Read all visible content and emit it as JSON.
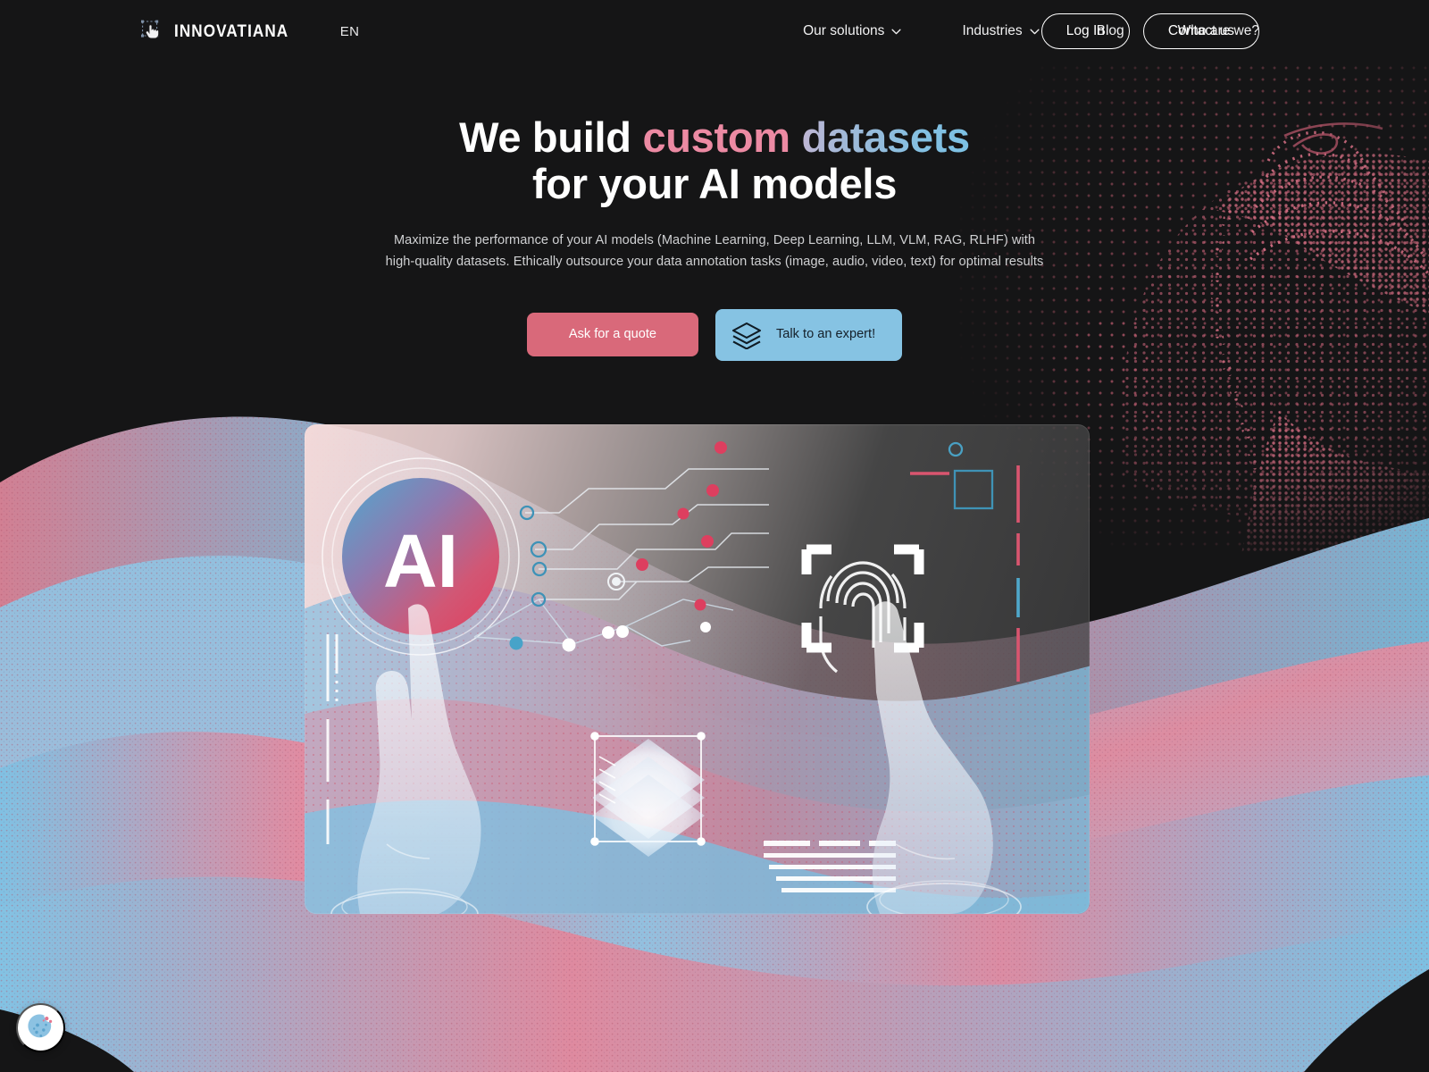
{
  "header": {
    "brand_name": "INNOVATIANA",
    "brand_icon": "hand-pointer-selection-icon",
    "language": "EN",
    "nav": [
      {
        "label": "Our solutions",
        "has_chevron": true,
        "icon": "chevron-down-icon"
      },
      {
        "label": "Industries",
        "has_chevron": true,
        "icon": "chevron-down-icon"
      },
      {
        "label": "Blog",
        "has_chevron": false,
        "icon": ""
      },
      {
        "label": "Who are we?",
        "has_chevron": false,
        "icon": ""
      }
    ],
    "login_label": "Log In",
    "contact_label": "Contact us"
  },
  "hero": {
    "headline_part1": "We build ",
    "headline_custom": "custom",
    "headline_space": " ",
    "headline_datasets": "datasets",
    "headline_line2": "for your AI models",
    "subcopy": "Maximize the performance of your AI models (Machine Learning, Deep Learning, LLM, VLM, RAG, RLHF) with high-quality datasets. Ethically outsource your data annotation tasks (image, audio, video, text) for optimal results",
    "cta_primary": "Ask for a quote",
    "cta_secondary": "Talk to an expert!",
    "cta_secondary_icon": "layers-stack-icon"
  },
  "illustration": {
    "badge_label": "AI",
    "alt": "Two hands touching a translucent interactive panel showing an AI node graph, a fingerprint scanner target, a 3D layered data cube and text lines"
  },
  "cookie": {
    "icon": "cookie-icon",
    "label": "Cookie preferences"
  },
  "colors": {
    "background": "#151516",
    "accent_pink": "#d9697a",
    "accent_blue": "#86c3e3",
    "headline_pink": "#ec8aa3",
    "headline_blue": "#7cc1e4",
    "wave_blue": "#7ec2e2",
    "wave_pink": "#e58a9e",
    "text_muted": "#cfd0d2"
  }
}
